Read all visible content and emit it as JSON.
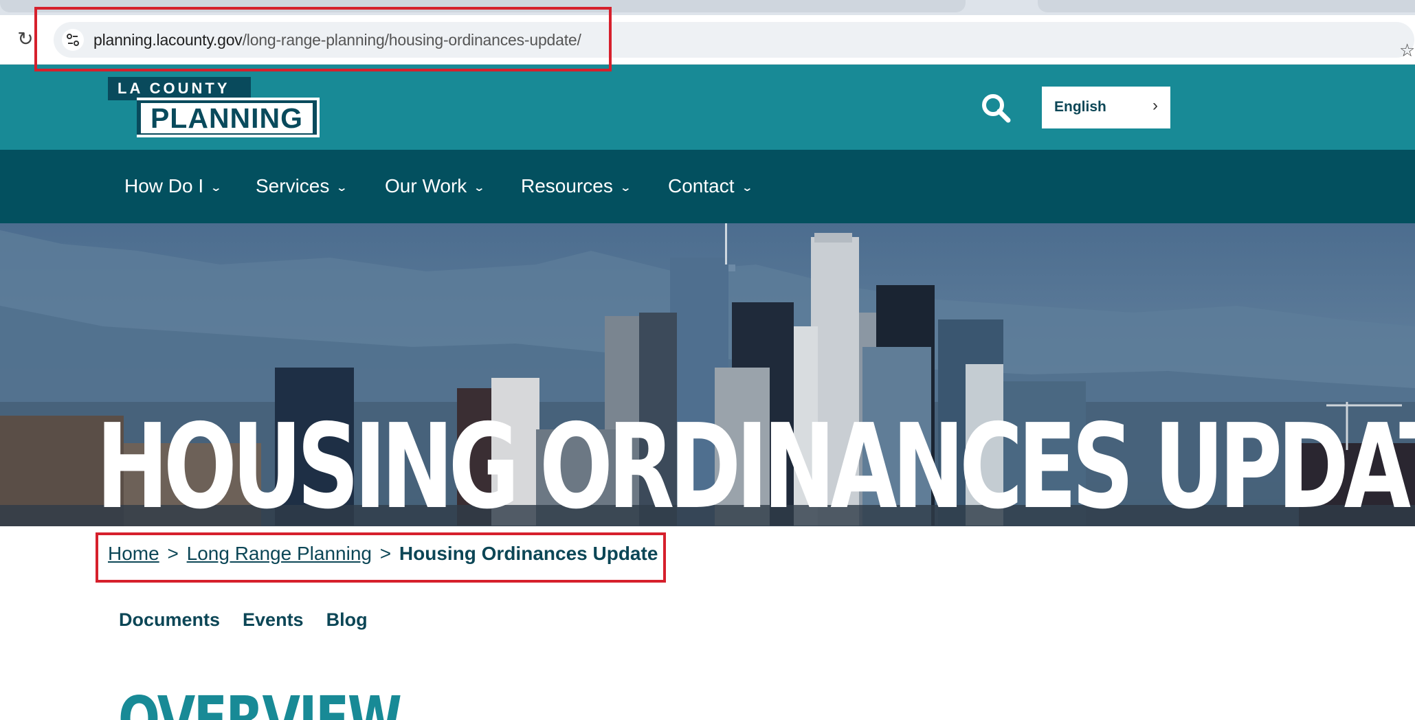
{
  "browser": {
    "url_host": "planning.lacounty.gov",
    "url_path": "/long-range-planning/housing-ordinances-update/"
  },
  "header": {
    "logo_top": "LA COUNTY",
    "logo_bottom": "PLANNING",
    "language_label": "English",
    "brand_color": "#188a96",
    "nav_color": "#03505f"
  },
  "nav": {
    "items": [
      {
        "label": "How Do I"
      },
      {
        "label": "Services"
      },
      {
        "label": "Our Work"
      },
      {
        "label": "Resources"
      },
      {
        "label": "Contact"
      }
    ]
  },
  "hero": {
    "title": "HOUSING ORDINANCES UPDATE"
  },
  "breadcrumb": {
    "home": "Home",
    "sep1": ">",
    "parent": "Long Range Planning",
    "sep2": ">",
    "current": "Housing Ordinances Update"
  },
  "subnav": {
    "items": [
      {
        "label": "Documents"
      },
      {
        "label": "Events"
      },
      {
        "label": "Blog"
      }
    ]
  },
  "main": {
    "heading": "OVERVIEW"
  },
  "annotations": {
    "highlight_color": "#d6202c"
  }
}
